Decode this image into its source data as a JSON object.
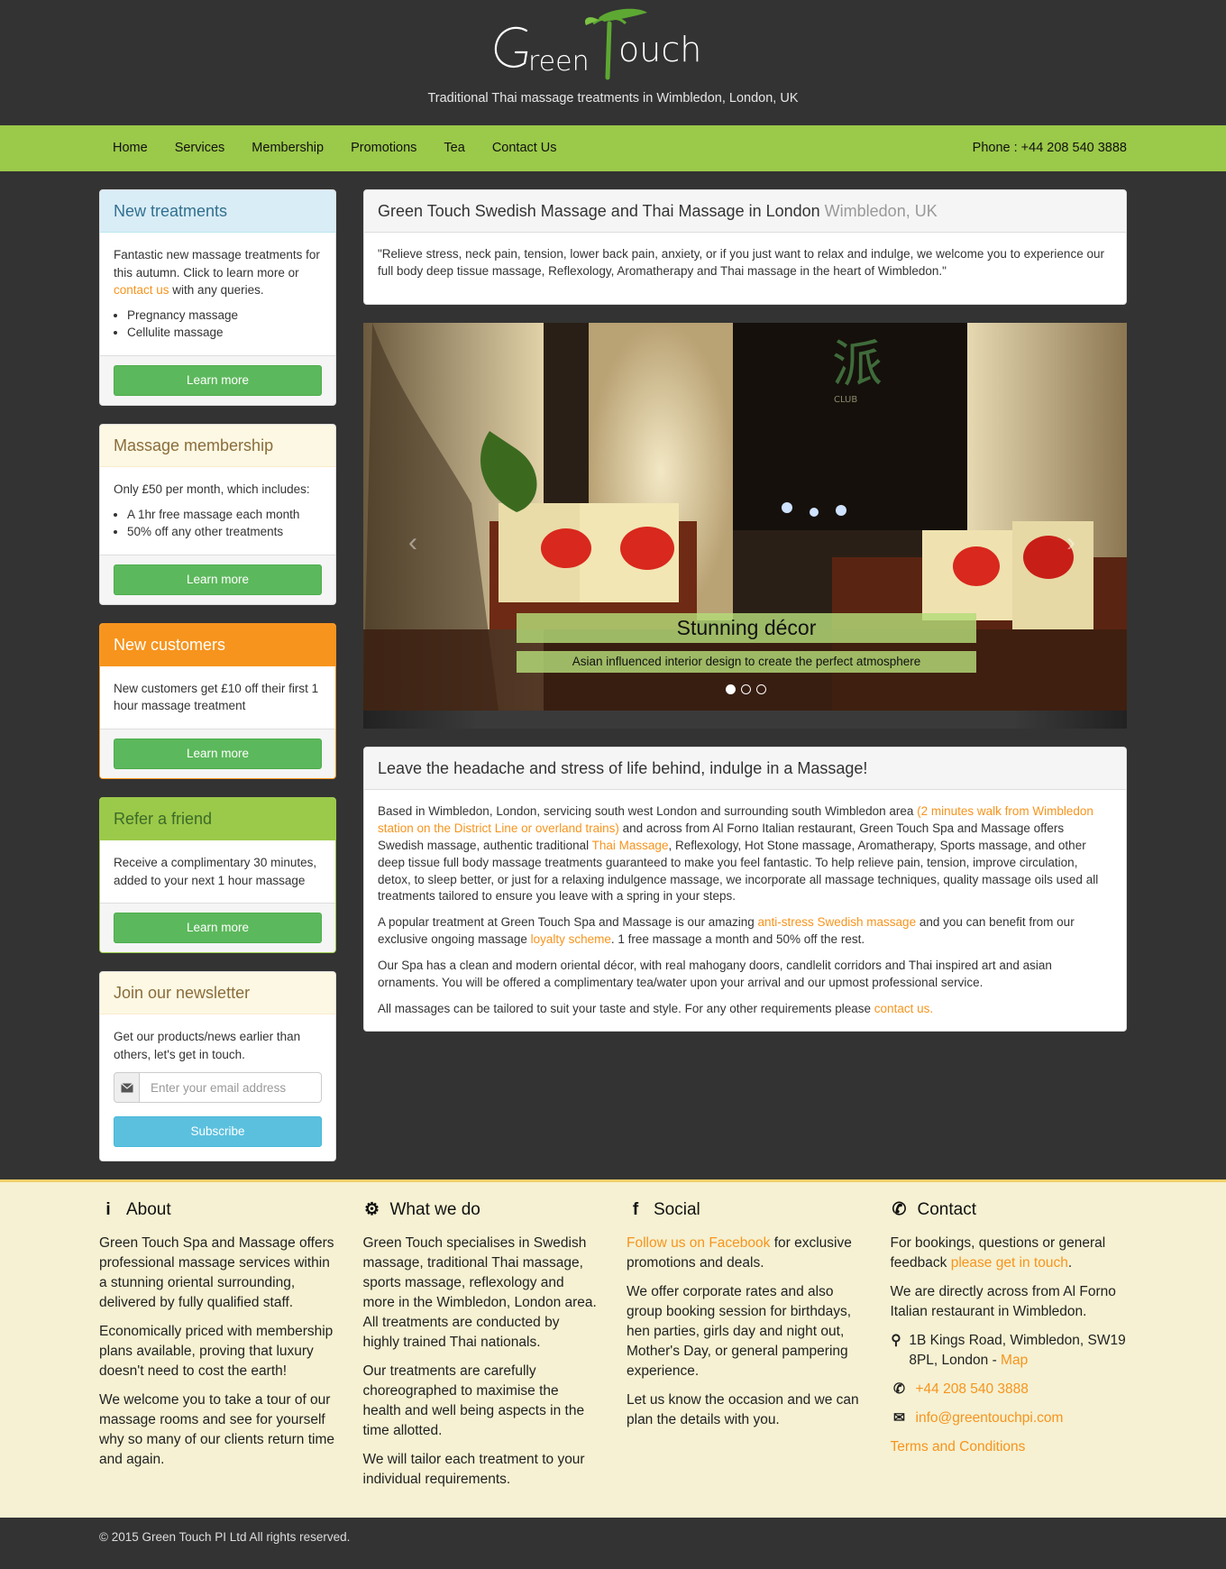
{
  "header": {
    "logo_text": "GreenTouch",
    "tagline": "Traditional Thai massage treatments in Wimbledon, London, UK"
  },
  "nav": {
    "items": [
      "Home",
      "Services",
      "Membership",
      "Promotions",
      "Tea",
      "Contact Us"
    ],
    "phone": "Phone : +44 208 540 3888"
  },
  "sidebar": {
    "new_treatments": {
      "title": "New treatments",
      "text_before": "Fantastic new massage treatments for this autumn. Click to learn more or ",
      "link": "contact us",
      "text_after": " with any queries.",
      "items": [
        "Pregnancy massage",
        "Cellulite massage"
      ],
      "button": "Learn more"
    },
    "membership": {
      "title": "Massage membership",
      "text": "Only £50 per month, which includes:",
      "items": [
        "A 1hr free massage each month",
        "50% off any other treatments"
      ],
      "button": "Learn more"
    },
    "new_customers": {
      "title": "New customers",
      "text": "New customers get £10 off their first 1 hour massage treatment",
      "button": "Learn more"
    },
    "refer": {
      "title": "Refer a friend",
      "text": "Receive a complimentary 30 minutes, added to your next 1 hour massage",
      "button": "Learn more"
    },
    "newsletter": {
      "title": "Join our newsletter",
      "text": "Get our products/news earlier than others, let's get in touch.",
      "placeholder": "Enter your email address",
      "button": "Subscribe"
    }
  },
  "intro": {
    "title": "Green Touch Swedish Massage and Thai Massage in London",
    "subtitle": "Wimbledon, UK",
    "quote": "\"Relieve stress, neck pain, tension, lower back pain, anxiety, or if you just want to relax and indulge, we welcome you to experience our full body deep tissue massage, Reflexology, Aromatherapy and Thai massage in the heart of Wimbledon.\""
  },
  "carousel": {
    "club_sign": "CLUB",
    "caption_title": "Stunning décor",
    "caption_text": "Asian influenced interior design to create the perfect atmosphere",
    "prev": "‹",
    "next": "›",
    "active_index": 0,
    "slide_count": 3
  },
  "article": {
    "title": "Leave the headache and stress of life behind, indulge in a Massage!",
    "p1_a": "Based in Wimbledon, London, servicing south west London and surrounding south Wimbledon area ",
    "p1_link1": "(2 minutes walk from Wimbledon station on the District Line or overland trains)",
    "p1_b": " and across from Al Forno Italian restaurant, Green Touch Spa and Massage offers Swedish massage, authentic traditional ",
    "p1_link2": "Thai Massage",
    "p1_c": ", Reflexology, Hot Stone massage, Aromatherapy, Sports massage, and other deep tissue full body massage treatments guaranteed to make you feel fantastic. To help relieve pain, tension, improve circulation, detox, to sleep better, or just for a relaxing indulgence massage, we incorporate all massage techniques, quality massage oils used all treatments tailored to ensure you leave with a spring in your steps.",
    "p2_a": "A popular treatment at Green Touch Spa and Massage is our amazing ",
    "p2_link1": "anti-stress Swedish massage",
    "p2_b": " and you can benefit from our exclusive ongoing massage ",
    "p2_link2": "loyalty scheme",
    "p2_c": ". 1 free massage a month and 50% off the rest.",
    "p3": "Our Spa has a clean and modern oriental décor, with real mahogany doors, candlelit corridors and Thai inspired art and asian ornaments. You will be offered a complimentary tea/water upon your arrival and our upmost professional service.",
    "p4_a": "All massages can be tailored to suit your taste and style. For any other requirements please ",
    "p4_link": "contact us."
  },
  "footer": {
    "about": {
      "title": "About",
      "icon": "info-icon",
      "p1": "Green Touch Spa and Massage offers professional massage services within a stunning oriental surrounding, delivered by fully qualified staff.",
      "p2": "Economically priced with membership plans available, proving that luxury doesn't need to cost the earth!",
      "p3": "We welcome you to take a tour of our massage rooms and see for yourself why so many of our clients return time and again."
    },
    "whatwedo": {
      "title": "What we do",
      "icon": "gears-icon",
      "p1": "Green Touch specialises in Swedish massage, traditional Thai massage, sports massage, reflexology and more in the Wimbledon, London area. All treatments are conducted by highly trained Thai nationals.",
      "p2": "Our treatments are carefully choreographed to maximise the health and well being aspects in the time allotted.",
      "p3": "We will tailor each treatment to your individual requirements."
    },
    "social": {
      "title": "Social",
      "icon": "facebook-icon",
      "p1_link": "Follow us on Facebook",
      "p1_text": " for exclusive promotions and deals.",
      "p2": "We offer corporate rates and also group booking session for birthdays, hen parties, girls day and night out, Mother's Day, or general pampering experience.",
      "p3": "Let us know the occasion and we can plan the details with you."
    },
    "contact": {
      "title": "Contact",
      "icon": "phone-icon",
      "p1_text": "For bookings, questions or general feedback ",
      "p1_link": "please get in touch",
      "p1_end": ".",
      "p2": "We are directly across from Al Forno Italian restaurant in Wimbledon.",
      "address": "1B Kings Road, Wimbledon, SW19 8PL, London - ",
      "map_link": "Map",
      "phone": "+44 208 540 3888",
      "email": "info@greentouchpi.com",
      "terms": "Terms and Conditions"
    }
  },
  "copyright": "© 2015 Green Touch PI Ltd All rights reserved."
}
